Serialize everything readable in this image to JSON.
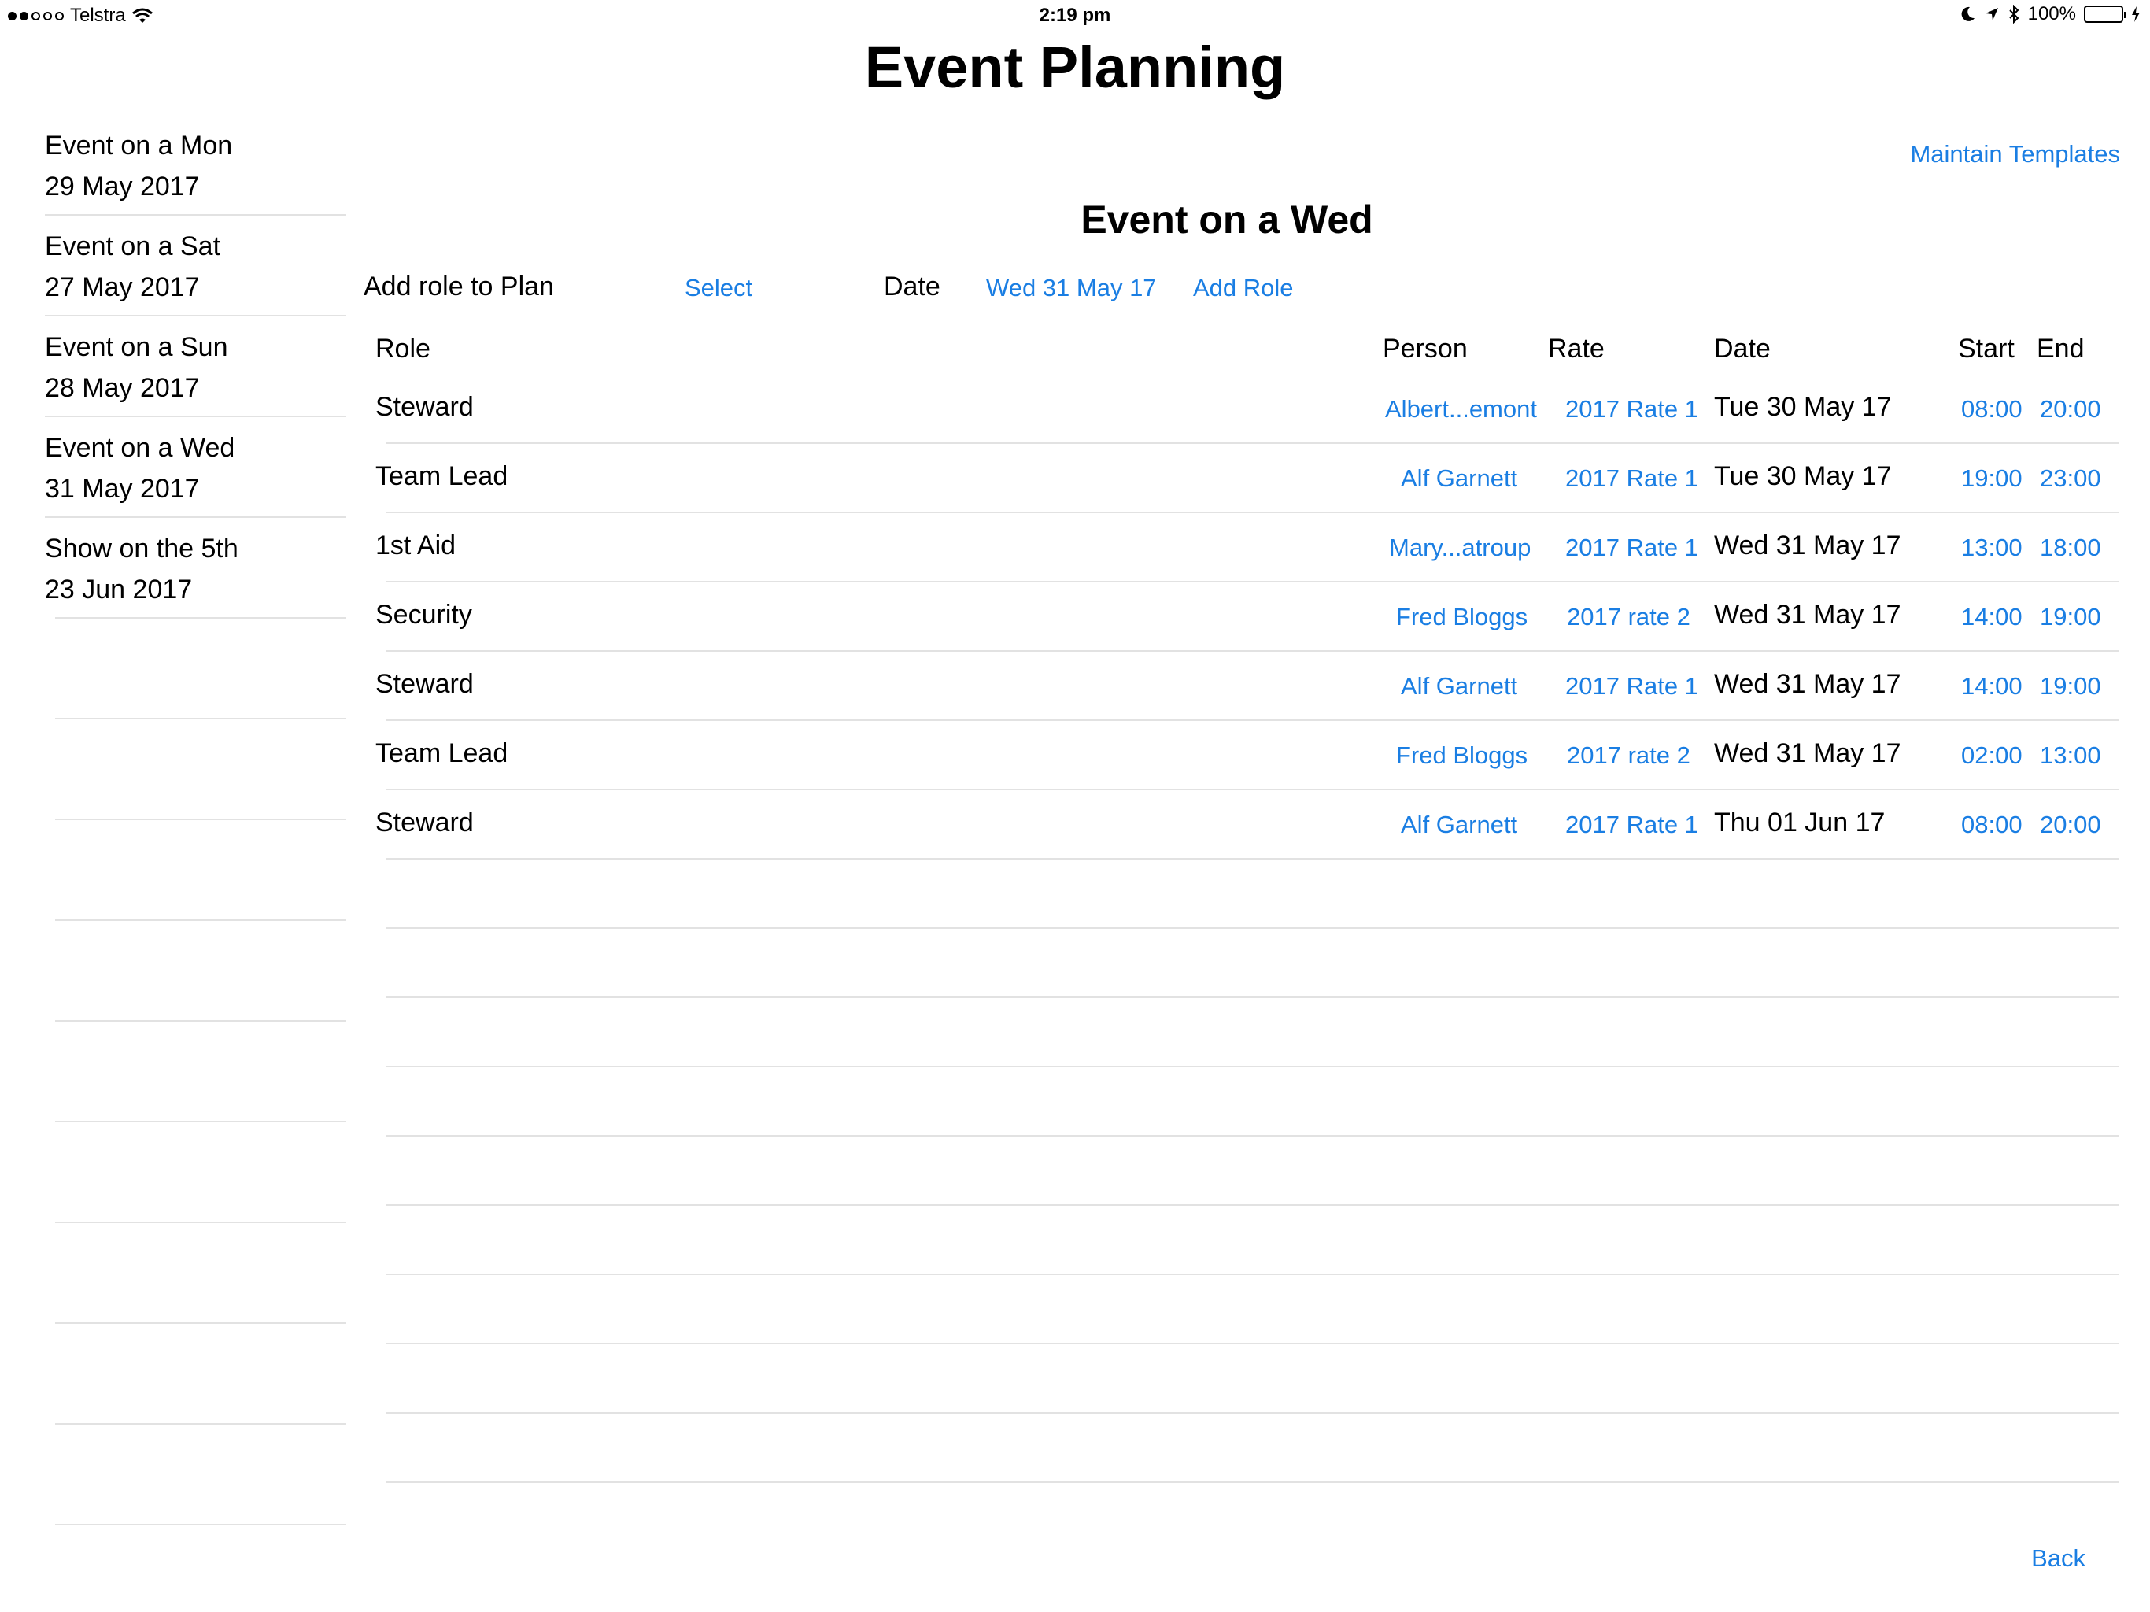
{
  "status_bar": {
    "carrier": "Telstra",
    "time": "2:19 pm",
    "battery": "100%"
  },
  "app_title": "Event Planning",
  "sidebar": {
    "items": [
      {
        "line1": "Event on a Mon",
        "line2": "29 May 2017"
      },
      {
        "line1": "Event on a Sat",
        "line2": "27 May 2017"
      },
      {
        "line1": "Event on a Sun",
        "line2": "28 May 2017"
      },
      {
        "line1": "Event on a Wed",
        "line2": "31 May 2017"
      },
      {
        "line1": "Show on the 5th",
        "line2": "23 Jun 2017"
      }
    ]
  },
  "maintain_templates": "Maintain Templates",
  "section_title": "Event on a Wed",
  "toolbar": {
    "add_role_label": "Add role to Plan",
    "select": "Select",
    "date_label": "Date",
    "date_value": "Wed 31 May 17",
    "add_role": "Add Role"
  },
  "table": {
    "headers": {
      "role": "Role",
      "person": "Person",
      "rate": "Rate",
      "date": "Date",
      "start": "Start",
      "end": "End"
    },
    "rows": [
      {
        "role": "Steward",
        "person": "Albert...emont",
        "rate": "2017 Rate 1",
        "date": "Tue 30 May 17",
        "start": "08:00",
        "end": "20:00"
      },
      {
        "role": "Team Lead",
        "person": "Alf Garnett",
        "rate": "2017 Rate 1",
        "date": "Tue 30 May 17",
        "start": "19:00",
        "end": "23:00"
      },
      {
        "role": "1st Aid",
        "person": "Mary...atroup",
        "rate": "2017 Rate 1",
        "date": "Wed 31 May 17",
        "start": "13:00",
        "end": "18:00"
      },
      {
        "role": "Security",
        "person": "Fred Bloggs",
        "rate": "2017 rate 2",
        "date": "Wed 31 May 17",
        "start": "14:00",
        "end": "19:00"
      },
      {
        "role": "Steward",
        "person": "Alf Garnett",
        "rate": "2017 Rate 1",
        "date": "Wed 31 May 17",
        "start": "14:00",
        "end": "19:00"
      },
      {
        "role": "Team Lead",
        "person": "Fred Bloggs",
        "rate": "2017 rate 2",
        "date": "Wed 31 May 17",
        "start": "02:00",
        "end": "13:00"
      },
      {
        "role": "Steward",
        "person": "Alf Garnett",
        "rate": "2017 Rate 1",
        "date": "Thu 01 Jun 17",
        "start": "08:00",
        "end": "20:00"
      }
    ]
  },
  "back": "Back",
  "colors": {
    "accent": "#1a7ee3",
    "separator": "#e2e2e2",
    "battery": "#4cd964"
  }
}
